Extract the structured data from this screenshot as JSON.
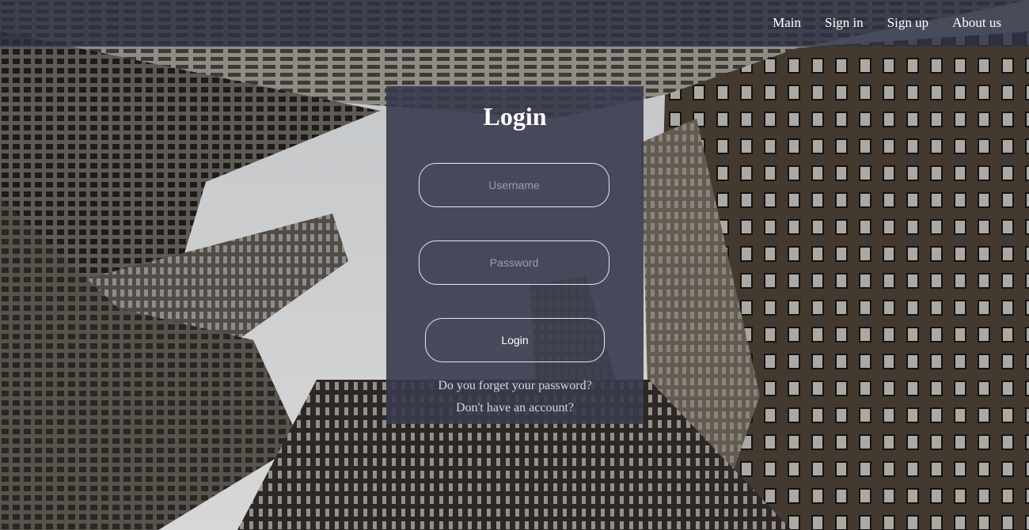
{
  "nav": {
    "items": [
      {
        "label": "Main"
      },
      {
        "label": "Sign in"
      },
      {
        "label": "Sign up"
      },
      {
        "label": "About us"
      }
    ]
  },
  "login_panel": {
    "title": "Login",
    "username_placeholder": "Username",
    "password_placeholder": "Password",
    "submit_label": "Login",
    "forgot_link": "Do you forget your password?",
    "signup_link": "Don't have an account?"
  },
  "colors": {
    "topbar": "#2c3042",
    "panel": "#383a4c",
    "text": "#ffffff",
    "link": "#d6d6de"
  }
}
